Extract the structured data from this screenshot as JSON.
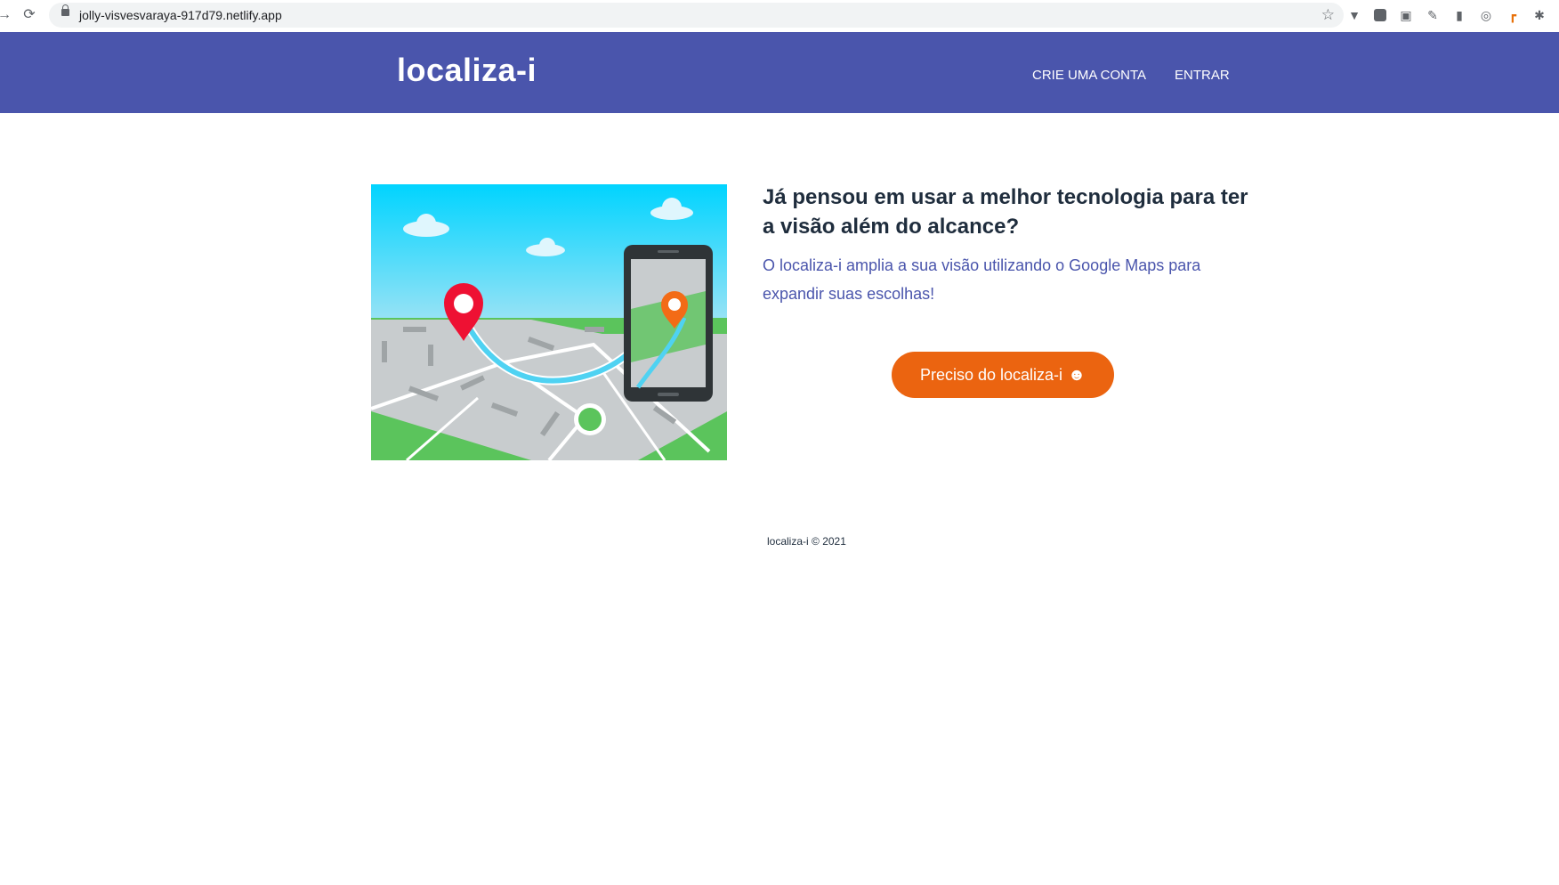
{
  "browser": {
    "url": "jolly-visvesvaraya-917d79.netlify.app"
  },
  "header": {
    "logo": "localiza-i",
    "nav": {
      "create_account": "CRIE UMA CONTA",
      "login": "ENTRAR"
    }
  },
  "hero": {
    "headline": "Já pensou em usar a melhor tecnologia para ter a visão além do alcance?",
    "description": "O localiza-i amplia a sua visão utilizando o Google Maps para expandir suas escolhas!",
    "cta_label": "Preciso do localiza-i",
    "cta_icon": "smiley-icon"
  },
  "footer": {
    "text": "localiza-i © 2021"
  },
  "colors": {
    "header_bg": "#4a55ac",
    "cta_bg": "#eb6410",
    "headline": "#1f2d3d",
    "description": "#4a55ac"
  }
}
